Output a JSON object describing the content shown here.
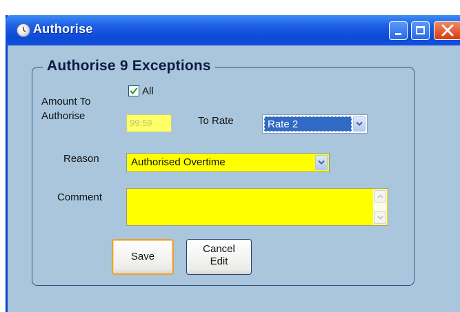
{
  "window": {
    "title": "Authorise",
    "icon": "clock-icon"
  },
  "group": {
    "title": "Authorise 9 Exceptions"
  },
  "amount": {
    "label_line1": "Amount To",
    "label_line2": "Authorise",
    "all_checkbox_label": "All",
    "all_checked": true,
    "value": "99:59"
  },
  "rate": {
    "label": "To Rate",
    "selected": "Rate 2"
  },
  "reason": {
    "label": "Reason",
    "selected": "Authorised Overtime"
  },
  "comment": {
    "label": "Comment",
    "value": ""
  },
  "buttons": {
    "save": "Save",
    "cancel_line1": "Cancel",
    "cancel_line2": "Edit"
  },
  "colors": {
    "titlebar": "#0b4ad6",
    "window_background": "#a9c6dc",
    "required_field": "#ffff00",
    "selection": "#316ac5"
  }
}
